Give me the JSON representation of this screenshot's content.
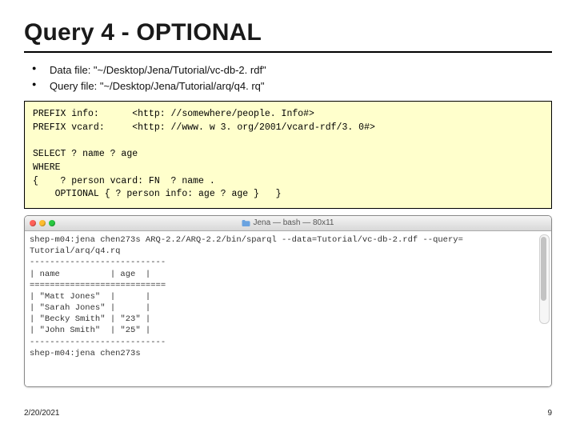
{
  "title": "Query 4 - OPTIONAL",
  "bullets": [
    "Data file: \"~/Desktop/Jena/Tutorial/vc-db-2. rdf\"",
    "Query file: \"~/Desktop/Jena/Tutorial/arq/q4. rq\""
  ],
  "code": "PREFIX info:      <http: //somewhere/people. Info#>\nPREFIX vcard:     <http: //www. w 3. org/2001/vcard-rdf/3. 0#>\n\nSELECT ? name ? age\nWHERE\n{    ? person vcard: FN  ? name .\n    OPTIONAL { ? person info: age ? age }   }",
  "terminal": {
    "window_title": "Jena — bash — 80x11",
    "lines": [
      "shep-m04:jena chen273s ARQ-2.2/ARQ-2.2/bin/sparql --data=Tutorial/vc-db-2.rdf --query=",
      "Tutorial/arq/q4.rq",
      "---------------------------",
      "| name          | age  |",
      "===========================",
      "| \"Matt Jones\"  |      |",
      "| \"Sarah Jones\" |      |",
      "| \"Becky Smith\" | \"23\" |",
      "| \"John Smith\"  | \"25\" |",
      "---------------------------",
      "shep-m04:jena chen273s"
    ]
  },
  "chart_data": {
    "type": "table",
    "title": "SPARQL query result",
    "columns": [
      "name",
      "age"
    ],
    "rows": [
      [
        "Matt Jones",
        null
      ],
      [
        "Sarah Jones",
        null
      ],
      [
        "Becky Smith",
        "23"
      ],
      [
        "John Smith",
        "25"
      ]
    ]
  },
  "footer": {
    "date": "2/20/2021",
    "page": "9"
  }
}
